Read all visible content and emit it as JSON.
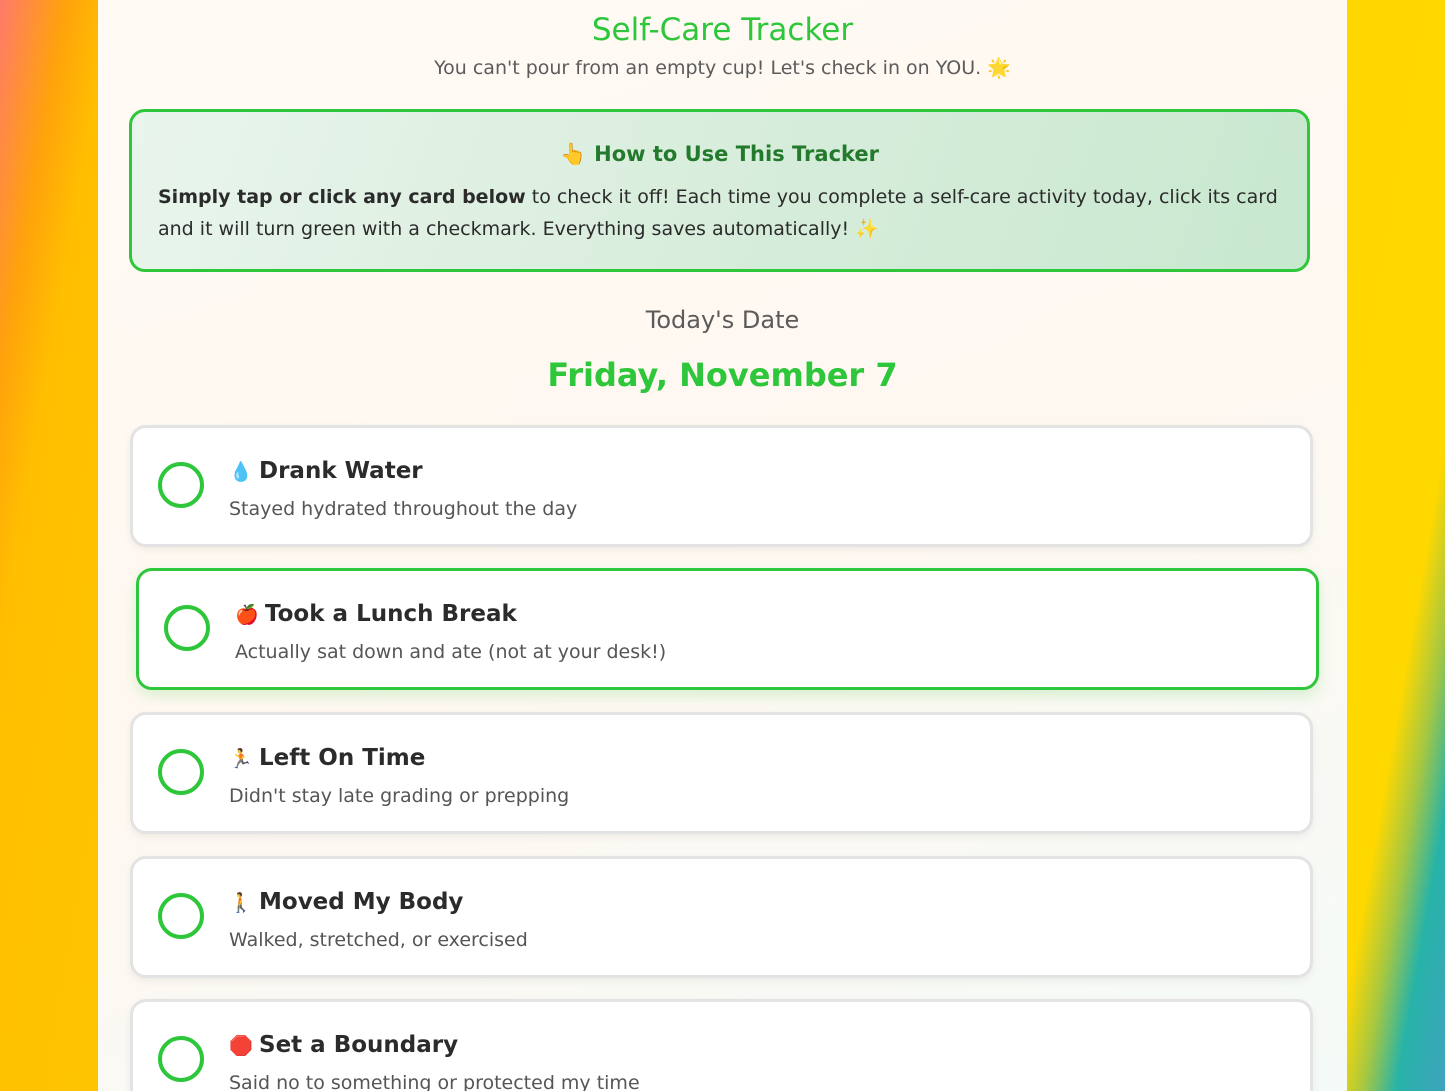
{
  "header": {
    "title": "Self-Care Tracker",
    "subtitle": "You can't pour from an empty cup! Let's check in on YOU.",
    "subtitle_emoji": "🌟"
  },
  "howto": {
    "emoji": "👆",
    "title": "How to Use This Tracker",
    "bold_text": "Simply tap or click any card below",
    "text": " to check it off! Each time you complete a self-care activity today, click its card and it will turn green with a checkmark. Everything saves automatically! ",
    "end_emoji": "✨"
  },
  "date": {
    "label": "Today's Date",
    "value": "Friday, November 7"
  },
  "cards": [
    {
      "emoji": "💧",
      "title": "Drank Water",
      "description": "Stayed hydrated throughout the day",
      "checked": false
    },
    {
      "emoji": "🍎",
      "title": "Took a Lunch Break",
      "description": "Actually sat down and ate (not at your desk!)",
      "checked": false,
      "hovered": true
    },
    {
      "emoji": "🏃",
      "title": "Left On Time",
      "description": "Didn't stay late grading or prepping",
      "checked": false
    },
    {
      "emoji": "🚶",
      "title": "Moved My Body",
      "description": "Walked, stretched, or exercised",
      "checked": false
    },
    {
      "emoji": "🛑",
      "title": "Set a Boundary",
      "description": "Said no to something or protected my time",
      "checked": false
    }
  ],
  "colors": {
    "accent": "#2ec63a",
    "howto_title": "#237a2c"
  }
}
